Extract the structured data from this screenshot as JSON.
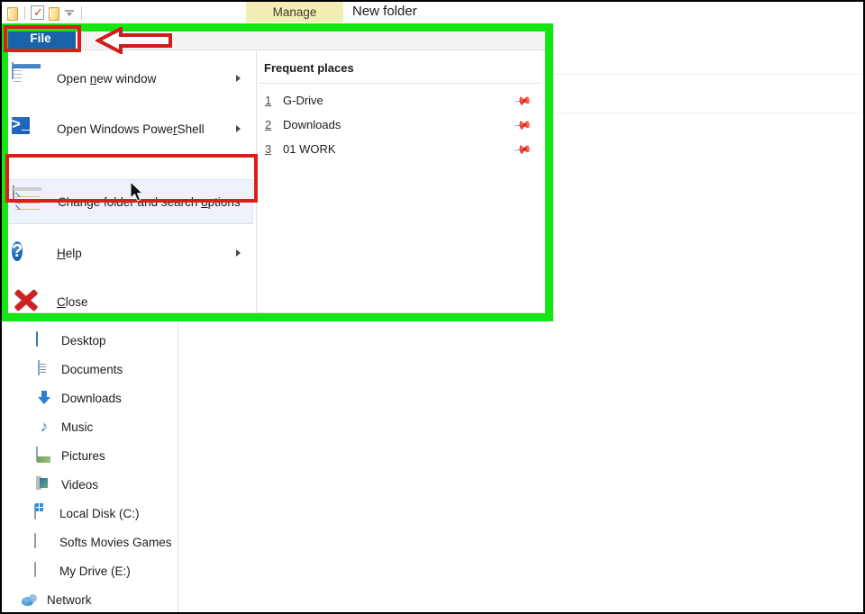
{
  "window": {
    "title": "New folder",
    "contextual_tab": "Manage",
    "file_tab_label": "File"
  },
  "quick_access": [
    {
      "name": "folder-icon",
      "tooltip": "Pin to Quick access"
    },
    {
      "name": "properties-icon",
      "tooltip": "Properties"
    },
    {
      "name": "new-folder-icon",
      "tooltip": "New folder"
    },
    {
      "name": "customize-dropdown-icon",
      "tooltip": "Customize Quick Access Toolbar"
    }
  ],
  "file_menu": {
    "items": [
      {
        "label": "Open new window",
        "accel": "n",
        "icon": "new-window-icon",
        "has_submenu": true,
        "highlighted": false
      },
      {
        "label": "Open Windows PowerShell",
        "accel": "r",
        "icon": "powershell-icon",
        "has_submenu": true,
        "highlighted": false
      },
      {
        "label": "Change folder and search options",
        "accel": "o",
        "icon": "folder-options-icon",
        "has_submenu": false,
        "highlighted": true
      },
      {
        "label": "Help",
        "accel": "H",
        "icon": "help-icon",
        "has_submenu": true,
        "highlighted": false
      },
      {
        "label": "Close",
        "accel": "C",
        "icon": "close-icon",
        "has_submenu": false,
        "highlighted": false
      }
    ]
  },
  "frequent_places": {
    "heading": "Frequent places",
    "items": [
      {
        "number": "1",
        "name": "G-Drive",
        "pin": "pin-icon"
      },
      {
        "number": "2",
        "name": "Downloads",
        "pin": "pin-icon"
      },
      {
        "number": "3",
        "name": "01 WORK",
        "pin": "pin-icon"
      }
    ]
  },
  "navigation_pane": {
    "items": [
      {
        "label": "Desktop",
        "icon": "desktop-icon"
      },
      {
        "label": "Documents",
        "icon": "documents-icon"
      },
      {
        "label": "Downloads",
        "icon": "downloads-icon"
      },
      {
        "label": "Music",
        "icon": "music-icon"
      },
      {
        "label": "Pictures",
        "icon": "pictures-icon"
      },
      {
        "label": "Videos",
        "icon": "videos-icon"
      },
      {
        "label": "Local Disk (C:)",
        "icon": "system-drive-icon"
      },
      {
        "label": "Softs Movies Games",
        "icon": "drive-icon"
      },
      {
        "label": "My Drive (E:)",
        "icon": "drive-icon"
      },
      {
        "label": "Network",
        "icon": "network-icon"
      }
    ]
  },
  "annotations": {
    "green_highlight_color": "#14e614",
    "red_outline_color": "#e01b1b",
    "arrow_direction": "left",
    "boxes": [
      {
        "target": "file-tab",
        "color": "#e01b1b"
      },
      {
        "target": "change-folder-and-search-options",
        "color": "#e01b1b"
      }
    ]
  },
  "colors": {
    "file_tab_bg": "#1a63a8",
    "contextual_tab_bg": "#f4eeb4",
    "hover_bg": "#eef3fb",
    "window_bg": "#ffffff"
  }
}
